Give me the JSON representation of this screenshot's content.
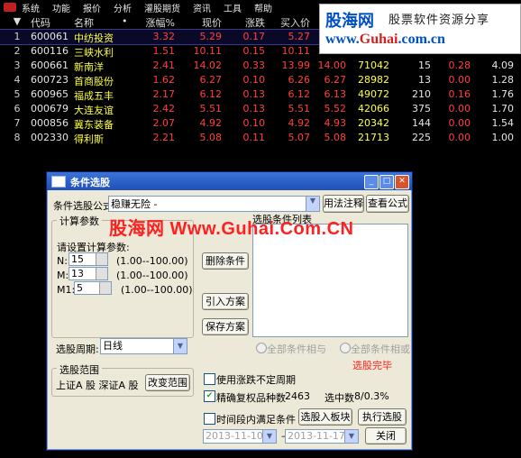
{
  "menu": [
    "系统",
    "功能",
    "报价",
    "分析",
    "灌股期货",
    "资讯",
    "工具",
    "帮助"
  ],
  "table": {
    "headers": [
      "代码",
      "名称",
      "•",
      "涨幅%",
      "现价",
      "涨跌",
      "买入价",
      "卖"
    ],
    "rows": [
      {
        "idx": "1",
        "code": "600061",
        "name": "中纺投资",
        "pct": "3.32",
        "price": "5.29",
        "chg": "0.17",
        "bid": "5.27",
        "ask": "",
        "vol": "",
        "x1": "",
        "x2": "",
        "x3": ""
      },
      {
        "idx": "2",
        "code": "600116",
        "name": "三峡水利",
        "pct": "1.51",
        "price": "10.11",
        "chg": "0.15",
        "bid": "10.11",
        "ask": "10.12",
        "vol": "63011",
        "x1": "34",
        "x2": "-0.09",
        "x3": "2.39"
      },
      {
        "idx": "3",
        "code": "600661",
        "name": "新南洋",
        "pct": "2.41",
        "price": "14.02",
        "chg": "0.33",
        "bid": "13.99",
        "ask": "14.00",
        "vol": "71042",
        "x1": "15",
        "x2": "0.28",
        "x3": "4.09"
      },
      {
        "idx": "4",
        "code": "600723",
        "name": "首商股份",
        "pct": "1.62",
        "price": "6.27",
        "chg": "0.10",
        "bid": "6.26",
        "ask": "6.27",
        "vol": "28982",
        "x1": "13",
        "x2": "0.00",
        "x3": "1.28"
      },
      {
        "idx": "5",
        "code": "600965",
        "name": "福成五丰",
        "pct": "2.17",
        "price": "6.12",
        "chg": "0.13",
        "bid": "6.12",
        "ask": "6.13",
        "vol": "49072",
        "x1": "210",
        "x2": "0.16",
        "x3": "1.76"
      },
      {
        "idx": "6",
        "code": "000679",
        "name": "大连友谊",
        "pct": "2.42",
        "price": "5.51",
        "chg": "0.13",
        "bid": "5.51",
        "ask": "5.52",
        "vol": "42066",
        "x1": "375",
        "x2": "0.00",
        "x3": "1.70"
      },
      {
        "idx": "7",
        "code": "000856",
        "name": "冀东装备",
        "pct": "2.07",
        "price": "4.92",
        "chg": "0.10",
        "bid": "4.92",
        "ask": "4.93",
        "vol": "20342",
        "x1": "144",
        "x2": "0.00",
        "x3": "1.54"
      },
      {
        "idx": "8",
        "code": "002330",
        "name": "得利斯",
        "pct": "2.21",
        "price": "5.08",
        "chg": "0.11",
        "bid": "5.07",
        "ask": "5.08",
        "vol": "21713",
        "x1": "225",
        "x2": "0.00",
        "x3": "1.00"
      }
    ]
  },
  "watermark": {
    "site": "股海网",
    "slogan": "股票软件资源分享",
    "url_a": "www.",
    "url_b": "Guhai",
    "url_c": ".com.cn"
  },
  "overlay_text": "股海网 Www.Guhai.Com.CN",
  "dialog": {
    "title": "条件选股",
    "formula_label": "条件选股公式",
    "formula_value": "稳赚无险 -",
    "btn_usage": "用法注释",
    "btn_view": "查看公式",
    "calc_group": "计算参数",
    "param_hint": "请设置计算参数:",
    "params": [
      {
        "name": "N:",
        "value": "15",
        "range": "(1.00--100.00)"
      },
      {
        "name": "M:",
        "value": "13",
        "range": "(1.00--100.00)"
      },
      {
        "name": "M1:",
        "value": "5",
        "range": "(1.00--100.00)"
      }
    ],
    "btn_delete": "删除条件",
    "btn_import": "引入方案",
    "btn_save": "保存方案",
    "cond_list_label": "选股条件列表",
    "period_label": "选股周期:",
    "period_value": "日线",
    "radio_and": "全部条件相与",
    "radio_or": "全部条件相或",
    "status": "选股完毕",
    "range_group": "选股范围",
    "range_value": "上证A 股  深证A 股",
    "btn_change_range": "改变范围",
    "chk_uncertain": "使用涨跌不定周期",
    "chk_exact": "精确复权",
    "count_label": "品种数",
    "count_value": "2463",
    "selected_label": "选中数",
    "selected_value": "8/0.3%",
    "chk_period": "时间段内满足条件",
    "btn_add_block": "选股入板块",
    "btn_run": "执行选股",
    "date_from": "2013-11-10",
    "date_sep": "—",
    "date_to": "2013-11-17",
    "btn_close": "关闭"
  }
}
